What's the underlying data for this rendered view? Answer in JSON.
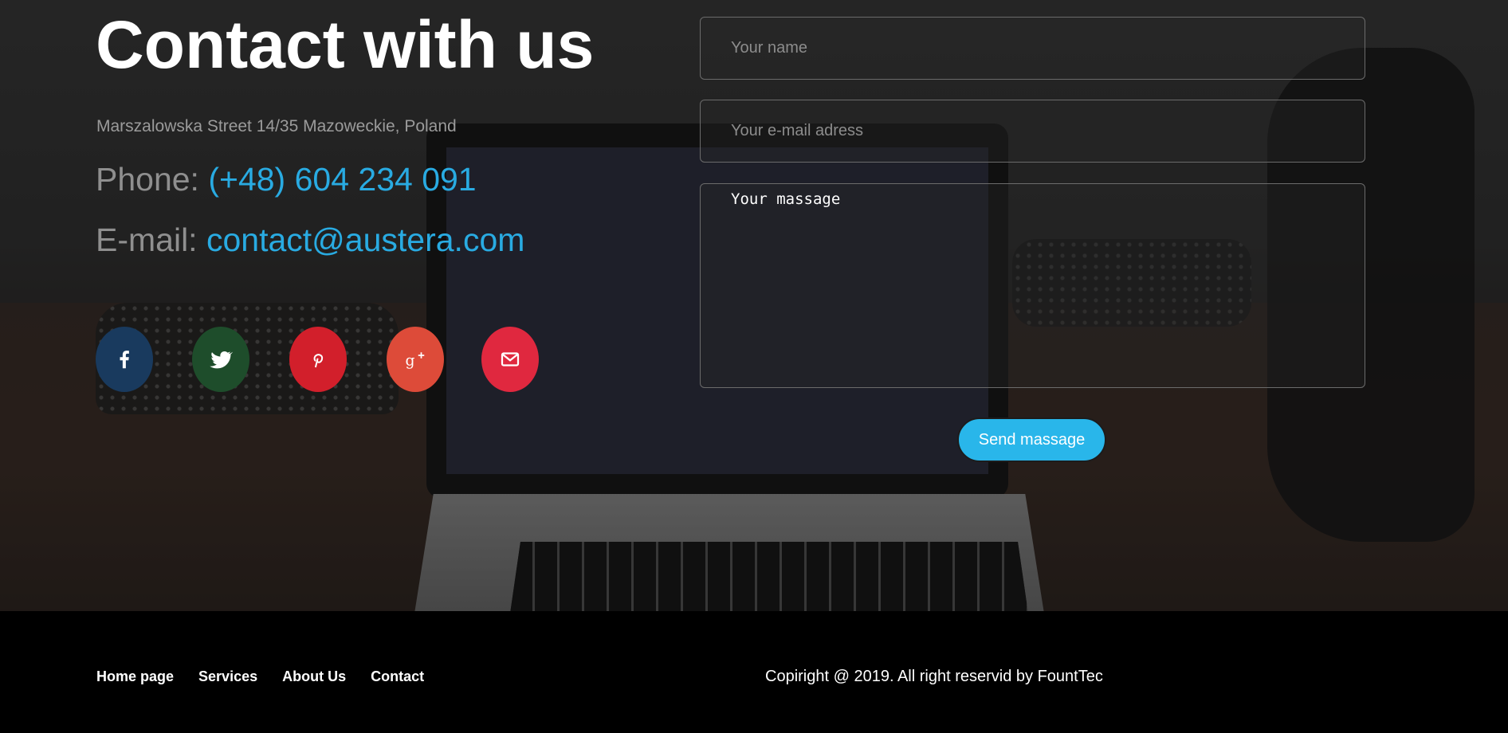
{
  "contact": {
    "title": "Contact with us",
    "address": "Marszalowska Street 14/35 Mazoweckie, Poland",
    "phone_label": "Phone:",
    "phone_value": "(+48) 604 234 091",
    "email_label": "E-mail:",
    "email_value": "contact@austera.com"
  },
  "social": [
    {
      "name": "facebook",
      "icon": "facebook-icon",
      "color": "#193a5e"
    },
    {
      "name": "twitter",
      "icon": "twitter-icon",
      "color": "#1e4d2b"
    },
    {
      "name": "pinterest",
      "icon": "pinterest-icon",
      "color": "#d21f2b"
    },
    {
      "name": "google-plus",
      "icon": "google-plus-icon",
      "color": "#dd4b39"
    },
    {
      "name": "mail",
      "icon": "mail-icon",
      "color": "#e0283f"
    }
  ],
  "form": {
    "name_placeholder": "Your name",
    "email_placeholder": "Your e-mail adress",
    "message_placeholder": "Your massage",
    "send_label": "Send massage",
    "accent_color": "#29b6ea"
  },
  "footer": {
    "nav": [
      "Home page",
      "Services",
      "About Us",
      "Contact"
    ],
    "copyright": "Copiright @ 2019. All right reservid by FountTec"
  },
  "colors": {
    "link": "#29abe2",
    "footer_bg": "#000000"
  }
}
